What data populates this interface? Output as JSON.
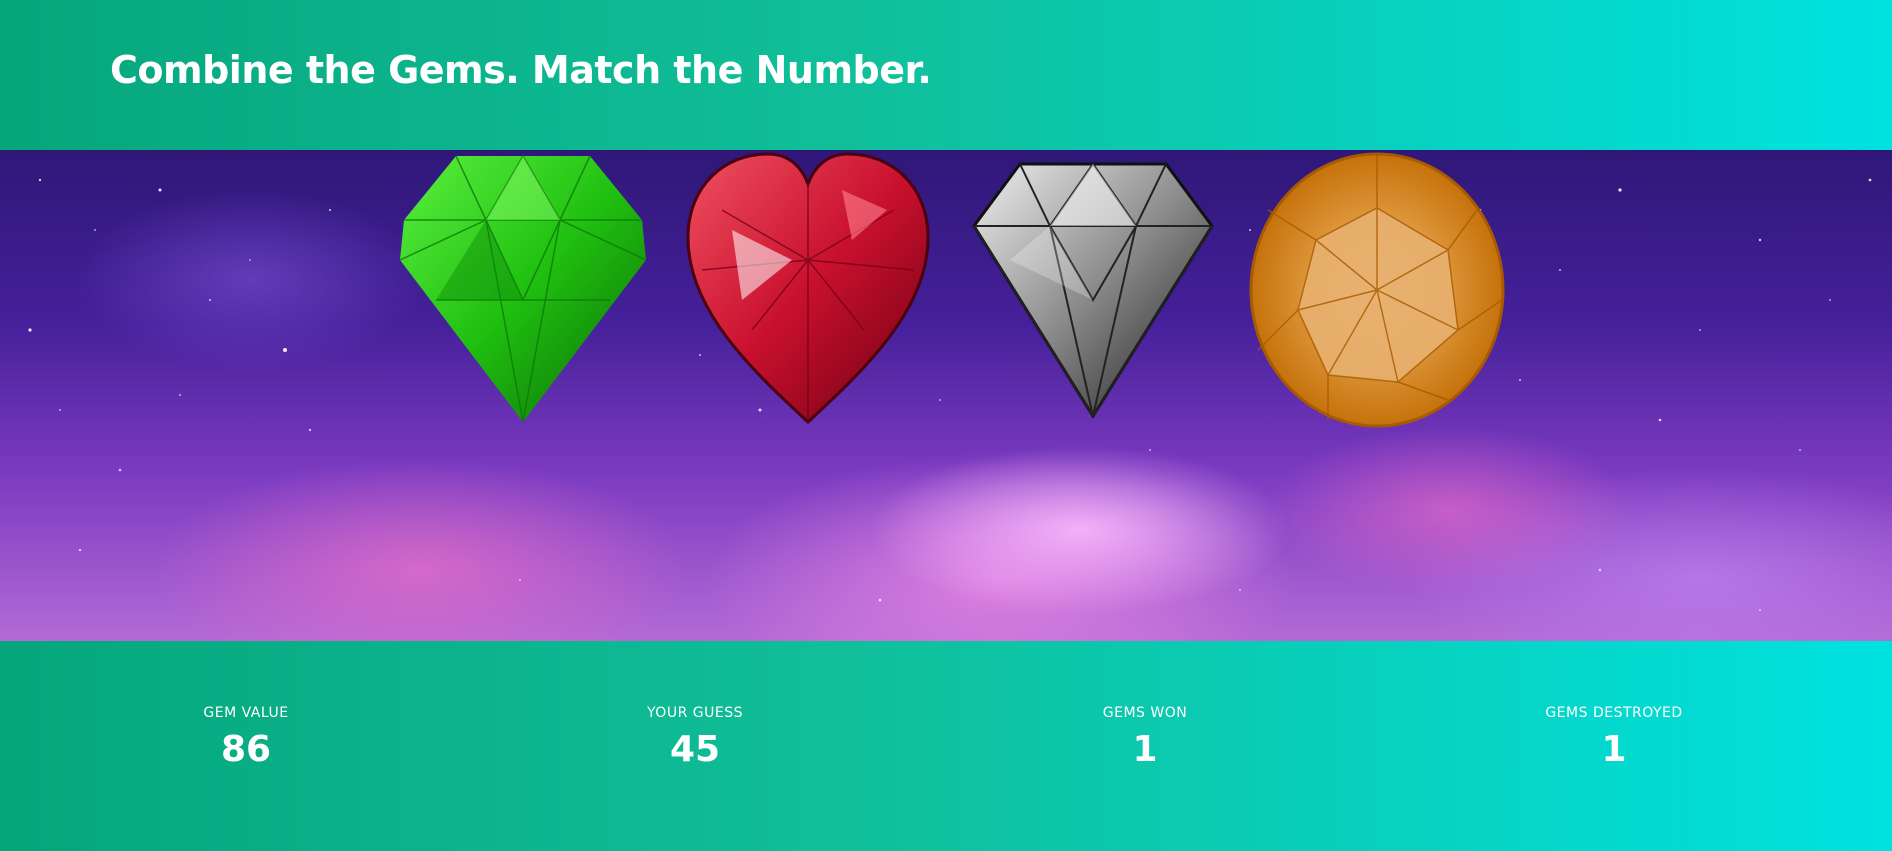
{
  "header": {
    "title": "Combine the Gems. Match the Number."
  },
  "gems": [
    {
      "name": "emerald",
      "icon": "green-gem-icon",
      "color": "#2fcf1a"
    },
    {
      "name": "ruby",
      "icon": "red-heart-gem-icon",
      "color": "#c8102e"
    },
    {
      "name": "diamond",
      "icon": "diamond-gem-icon",
      "color": "#9a9a9a"
    },
    {
      "name": "topaz",
      "icon": "orange-round-gem-icon",
      "color": "#e8890c"
    }
  ],
  "stats": [
    {
      "label": "GEM VALUE",
      "value": "86"
    },
    {
      "label": "YOUR GUESS",
      "value": "45"
    },
    {
      "label": "GEMS WON",
      "value": "1"
    },
    {
      "label": "GEMS DESTROYED",
      "value": "1"
    }
  ],
  "colors": {
    "gradient_start": "#06a67c",
    "gradient_end": "#00e2e0",
    "text": "#ffffff"
  }
}
